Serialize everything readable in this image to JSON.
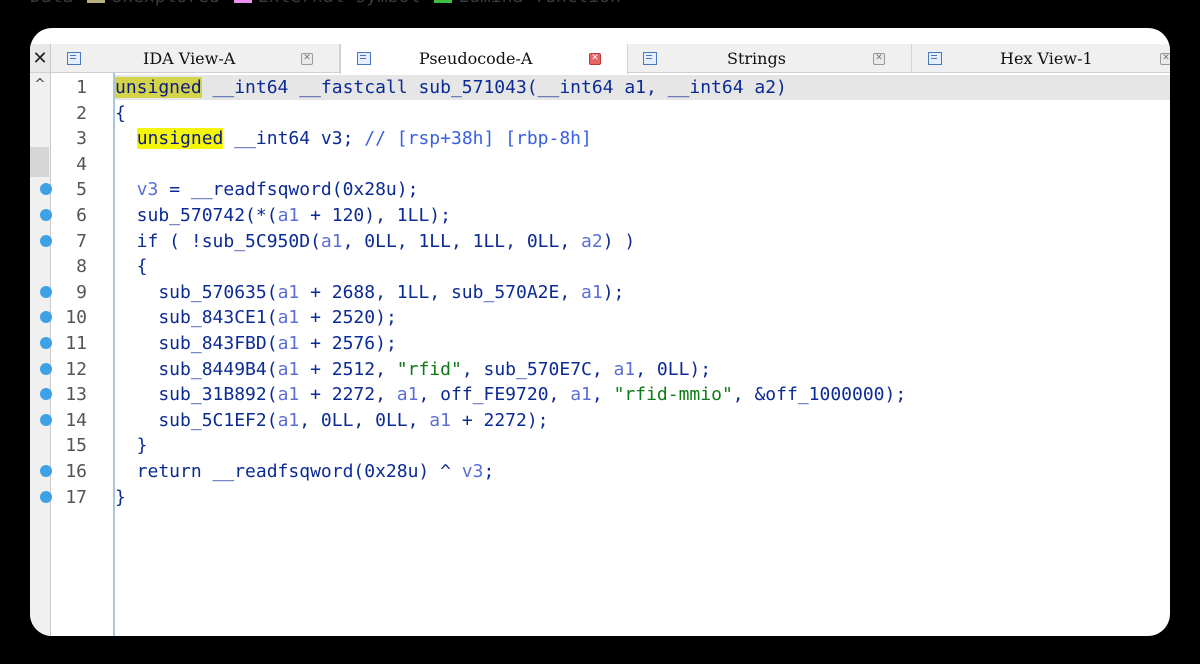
{
  "legend": {
    "items": [
      {
        "label": "Data",
        "color": "#c8c8c8"
      },
      {
        "label": "Unexplored",
        "color": "#b5b080"
      },
      {
        "label": "External symbol",
        "color": "#f08ef0"
      },
      {
        "label": "Lumina function",
        "color": "#3fbf3f"
      }
    ]
  },
  "window": {
    "close_label": "✕",
    "scroll_up_label": "^"
  },
  "tabs": [
    {
      "label": "IDA View-A",
      "close": "✕",
      "active": false
    },
    {
      "label": "Pseudocode-A",
      "close": "✕",
      "active": true
    },
    {
      "label": "Strings",
      "close": "✕",
      "active": false
    },
    {
      "label": "Hex View-1",
      "close": "✕",
      "active": false
    }
  ],
  "code": {
    "lines": [
      {
        "num": "1",
        "bp": false,
        "current": true,
        "segs": [
          [
            "hl2",
            "unsigned"
          ],
          [
            "kw",
            " __int64 __fastcall sub_571043(__int64 a1, __int64 a2)"
          ]
        ]
      },
      {
        "num": "2",
        "bp": false,
        "current": false,
        "segs": [
          [
            "kw",
            "{"
          ]
        ]
      },
      {
        "num": "3",
        "bp": false,
        "current": false,
        "segs": [
          [
            "kw",
            "  "
          ],
          [
            "hl",
            "unsigned"
          ],
          [
            "kw",
            " __int64 v3; "
          ],
          [
            "cmt",
            "// [rsp+38h] [rbp-8h]"
          ]
        ]
      },
      {
        "num": "4",
        "bp": false,
        "current": false,
        "segs": [
          [
            "kw",
            ""
          ]
        ]
      },
      {
        "num": "5",
        "bp": true,
        "current": false,
        "segs": [
          [
            "arg",
            "  v3"
          ],
          [
            "kw",
            " = __readfsqword(0x28u);"
          ]
        ]
      },
      {
        "num": "6",
        "bp": true,
        "current": false,
        "segs": [
          [
            "kw",
            "  sub_570742(*("
          ],
          [
            "arg",
            "a1"
          ],
          [
            "kw",
            " + 120), 1LL);"
          ]
        ]
      },
      {
        "num": "7",
        "bp": true,
        "current": false,
        "segs": [
          [
            "kw",
            "  if ( !sub_5C950D("
          ],
          [
            "arg",
            "a1"
          ],
          [
            "kw",
            ", 0LL, 1LL, 1LL, 0LL, "
          ],
          [
            "arg",
            "a2"
          ],
          [
            "kw",
            ") )"
          ]
        ]
      },
      {
        "num": "8",
        "bp": false,
        "current": false,
        "segs": [
          [
            "kw",
            "  {"
          ]
        ]
      },
      {
        "num": "9",
        "bp": true,
        "current": false,
        "segs": [
          [
            "kw",
            "    sub_570635("
          ],
          [
            "arg",
            "a1"
          ],
          [
            "kw",
            " + 2688, 1LL, sub_570A2E, "
          ],
          [
            "arg",
            "a1"
          ],
          [
            "kw",
            ");"
          ]
        ]
      },
      {
        "num": "10",
        "bp": true,
        "current": false,
        "segs": [
          [
            "kw",
            "    sub_843CE1("
          ],
          [
            "arg",
            "a1"
          ],
          [
            "kw",
            " + 2520);"
          ]
        ]
      },
      {
        "num": "11",
        "bp": true,
        "current": false,
        "segs": [
          [
            "kw",
            "    sub_843FBD("
          ],
          [
            "arg",
            "a1"
          ],
          [
            "kw",
            " + 2576);"
          ]
        ]
      },
      {
        "num": "12",
        "bp": true,
        "current": false,
        "segs": [
          [
            "kw",
            "    sub_8449B4("
          ],
          [
            "arg",
            "a1"
          ],
          [
            "kw",
            " + 2512, "
          ],
          [
            "str",
            "\"rfid\""
          ],
          [
            "kw",
            ", sub_570E7C, "
          ],
          [
            "arg",
            "a1"
          ],
          [
            "kw",
            ", 0LL);"
          ]
        ]
      },
      {
        "num": "13",
        "bp": true,
        "current": false,
        "segs": [
          [
            "kw",
            "    sub_31B892("
          ],
          [
            "arg",
            "a1"
          ],
          [
            "kw",
            " + 2272, "
          ],
          [
            "arg",
            "a1"
          ],
          [
            "kw",
            ", off_FE9720, "
          ],
          [
            "arg",
            "a1"
          ],
          [
            "kw",
            ", "
          ],
          [
            "str",
            "\"rfid-mmio\""
          ],
          [
            "kw",
            ", &off_1000000);"
          ]
        ]
      },
      {
        "num": "14",
        "bp": true,
        "current": false,
        "segs": [
          [
            "kw",
            "    sub_5C1EF2("
          ],
          [
            "arg",
            "a1"
          ],
          [
            "kw",
            ", 0LL, 0LL, "
          ],
          [
            "arg",
            "a1"
          ],
          [
            "kw",
            " + 2272);"
          ]
        ]
      },
      {
        "num": "15",
        "bp": false,
        "current": false,
        "segs": [
          [
            "kw",
            "  }"
          ]
        ]
      },
      {
        "num": "16",
        "bp": true,
        "current": false,
        "segs": [
          [
            "kw",
            "  return __readfsqword(0x28u) ^ "
          ],
          [
            "arg",
            "v3"
          ],
          [
            "kw",
            ";"
          ]
        ]
      },
      {
        "num": "17",
        "bp": true,
        "current": false,
        "segs": [
          [
            "kw",
            "}"
          ]
        ]
      }
    ]
  }
}
